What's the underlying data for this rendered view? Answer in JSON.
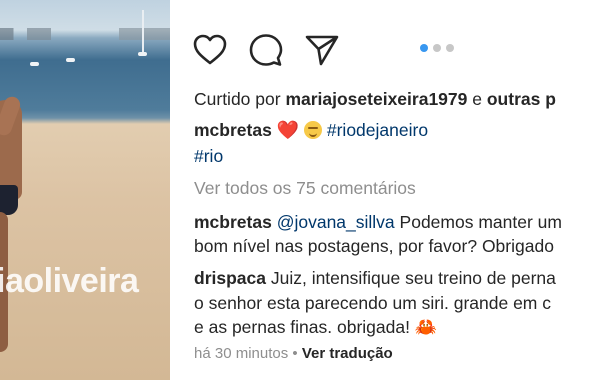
{
  "photo": {
    "watermark": "iaoliveira"
  },
  "actions": {
    "like_icon": "heart-outline-icon",
    "comment_icon": "comment-bubble-icon",
    "share_icon": "paper-plane-icon"
  },
  "carousel": {
    "count": 3,
    "active": 1
  },
  "likes": {
    "prefix": "Curtido por ",
    "user": "mariajoseteixeira1979",
    "middle": " e ",
    "others": "outras p"
  },
  "caption": {
    "user": "mcbretas",
    "emoji1": "❤️",
    "hashtag1": "#riodejaneiro",
    "hashtag2": "#rio"
  },
  "view_all": "Ver todos os 75 comentários",
  "comments": [
    {
      "user": "mcbretas",
      "mention": "@jovana_sillva",
      "line1": " Podemos manter um",
      "line2": "bom nível nas postagens, por favor? Obrigado"
    },
    {
      "user": "drispaca",
      "line1": " Juiz, intensifique seu treino de perna",
      "line2": "o senhor esta parecendo um siri. grande em c",
      "line3": "e as pernas finas. obrigada! ",
      "emoji": "🦀"
    }
  ],
  "footer": {
    "time": "há 30 minutos",
    "separator": " • ",
    "translate": "Ver tradução"
  }
}
